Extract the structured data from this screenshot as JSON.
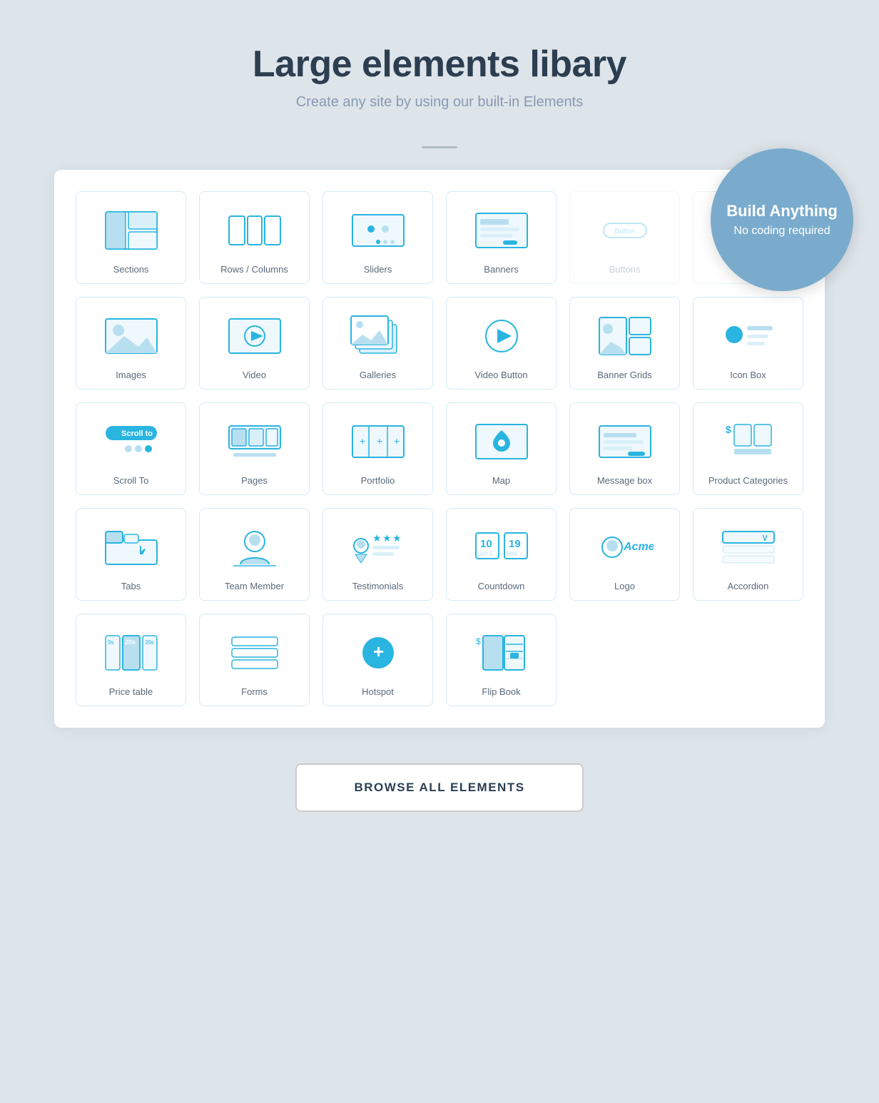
{
  "header": {
    "title": "Large elements libary",
    "subtitle": "Create any site by using our built-in Elements"
  },
  "build_circle": {
    "title": "Build Anything",
    "subtitle": "No coding required"
  },
  "browse_button": "BROWSE ALL ELEMENTS",
  "elements": [
    {
      "id": "sections",
      "label": "Sections",
      "icon": "sections"
    },
    {
      "id": "rows-columns",
      "label": "Rows / Columns",
      "icon": "rows-columns"
    },
    {
      "id": "sliders",
      "label": "Sliders",
      "icon": "sliders"
    },
    {
      "id": "banners",
      "label": "Banners",
      "icon": "banners"
    },
    {
      "id": "buttons",
      "label": "Buttons",
      "icon": "buttons"
    },
    {
      "id": "icon-box-placeholder",
      "label": "",
      "icon": "hidden"
    },
    {
      "id": "images",
      "label": "Images",
      "icon": "images"
    },
    {
      "id": "video",
      "label": "Video",
      "icon": "video"
    },
    {
      "id": "galleries",
      "label": "Galleries",
      "icon": "galleries"
    },
    {
      "id": "video-button",
      "label": "Video Button",
      "icon": "video-button"
    },
    {
      "id": "banner-grids",
      "label": "Banner Grids",
      "icon": "banner-grids"
    },
    {
      "id": "icon-box",
      "label": "Icon Box",
      "icon": "icon-box"
    },
    {
      "id": "scroll-to",
      "label": "Scroll To",
      "icon": "scroll-to"
    },
    {
      "id": "pages",
      "label": "Pages",
      "icon": "pages"
    },
    {
      "id": "portfolio",
      "label": "Portfolio",
      "icon": "portfolio"
    },
    {
      "id": "map",
      "label": "Map",
      "icon": "map"
    },
    {
      "id": "message-box",
      "label": "Message box",
      "icon": "message-box"
    },
    {
      "id": "product-categories",
      "label": "Product Categories",
      "icon": "product-categories"
    },
    {
      "id": "tabs",
      "label": "Tabs",
      "icon": "tabs"
    },
    {
      "id": "team-member",
      "label": "Team Member",
      "icon": "team-member"
    },
    {
      "id": "testimonials",
      "label": "Testimonials",
      "icon": "testimonials"
    },
    {
      "id": "countdown",
      "label": "Countdown",
      "icon": "countdown"
    },
    {
      "id": "logo",
      "label": "Logo",
      "icon": "logo"
    },
    {
      "id": "accordion",
      "label": "Accordion",
      "icon": "accordion"
    },
    {
      "id": "price-table",
      "label": "Price table",
      "icon": "price-table"
    },
    {
      "id": "forms",
      "label": "Forms",
      "icon": "forms"
    },
    {
      "id": "hotspot",
      "label": "Hotspot",
      "icon": "hotspot"
    },
    {
      "id": "flip-book",
      "label": "Flip Book",
      "icon": "flip-book"
    }
  ],
  "colors": {
    "primary": "#1ab0e0",
    "light_blue": "#b8dff0",
    "icon_stroke": "#2ab4e0",
    "text_dark": "#2c3e50",
    "text_light": "#8a9ab0"
  }
}
